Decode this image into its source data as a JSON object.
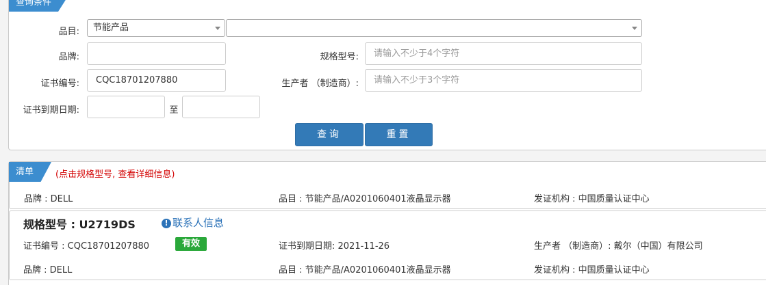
{
  "query_panel": {
    "tab_label": "查询条件",
    "category_label": "品目:",
    "category_value": "节能产品",
    "subcategory_value": "",
    "brand_label": "品牌:",
    "brand_value": "",
    "model_label": "规格型号:",
    "model_placeholder": "请输入不少于4个字符",
    "cert_no_label": "证书编号:",
    "cert_no_value": "CQC18701207880",
    "manufacturer_label": "生产者 （制造商）:",
    "manufacturer_placeholder": "请输入不少于3个字符",
    "expiry_label": "证书到期日期:",
    "expiry_from": "",
    "expiry_sep": "至",
    "expiry_to": "",
    "search_button": "查询",
    "reset_button": "重置"
  },
  "list_panel": {
    "tab_label": "清单",
    "hint": "(点击规格型号, 查看详细信息)",
    "prev_row": {
      "brand": "品牌 : DELL",
      "category": "品目 : 节能产品/A0201060401液晶显示器",
      "issuer": "发证机构 : 中国质量认证中心"
    },
    "item": {
      "model_title": "规格型号 : U2719DS",
      "contact_link": "联系人信息",
      "cert_no": "证书编号 : CQC18701207880",
      "status_badge": "有效",
      "expiry": "证书到期日期: 2021-11-26",
      "manufacturer": "生产者 （制造商）: 戴尔（中国）有限公司",
      "brand": "品牌 : DELL",
      "category": "品目 : 节能产品/A0201060401液晶显示器",
      "issuer": "发证机构 : 中国质量认证中心"
    }
  },
  "colors": {
    "accent": "#3c8dcf",
    "button": "#337ab7",
    "hint": "#d30000",
    "badge": "#2aa83a",
    "link": "#2b72b8"
  }
}
